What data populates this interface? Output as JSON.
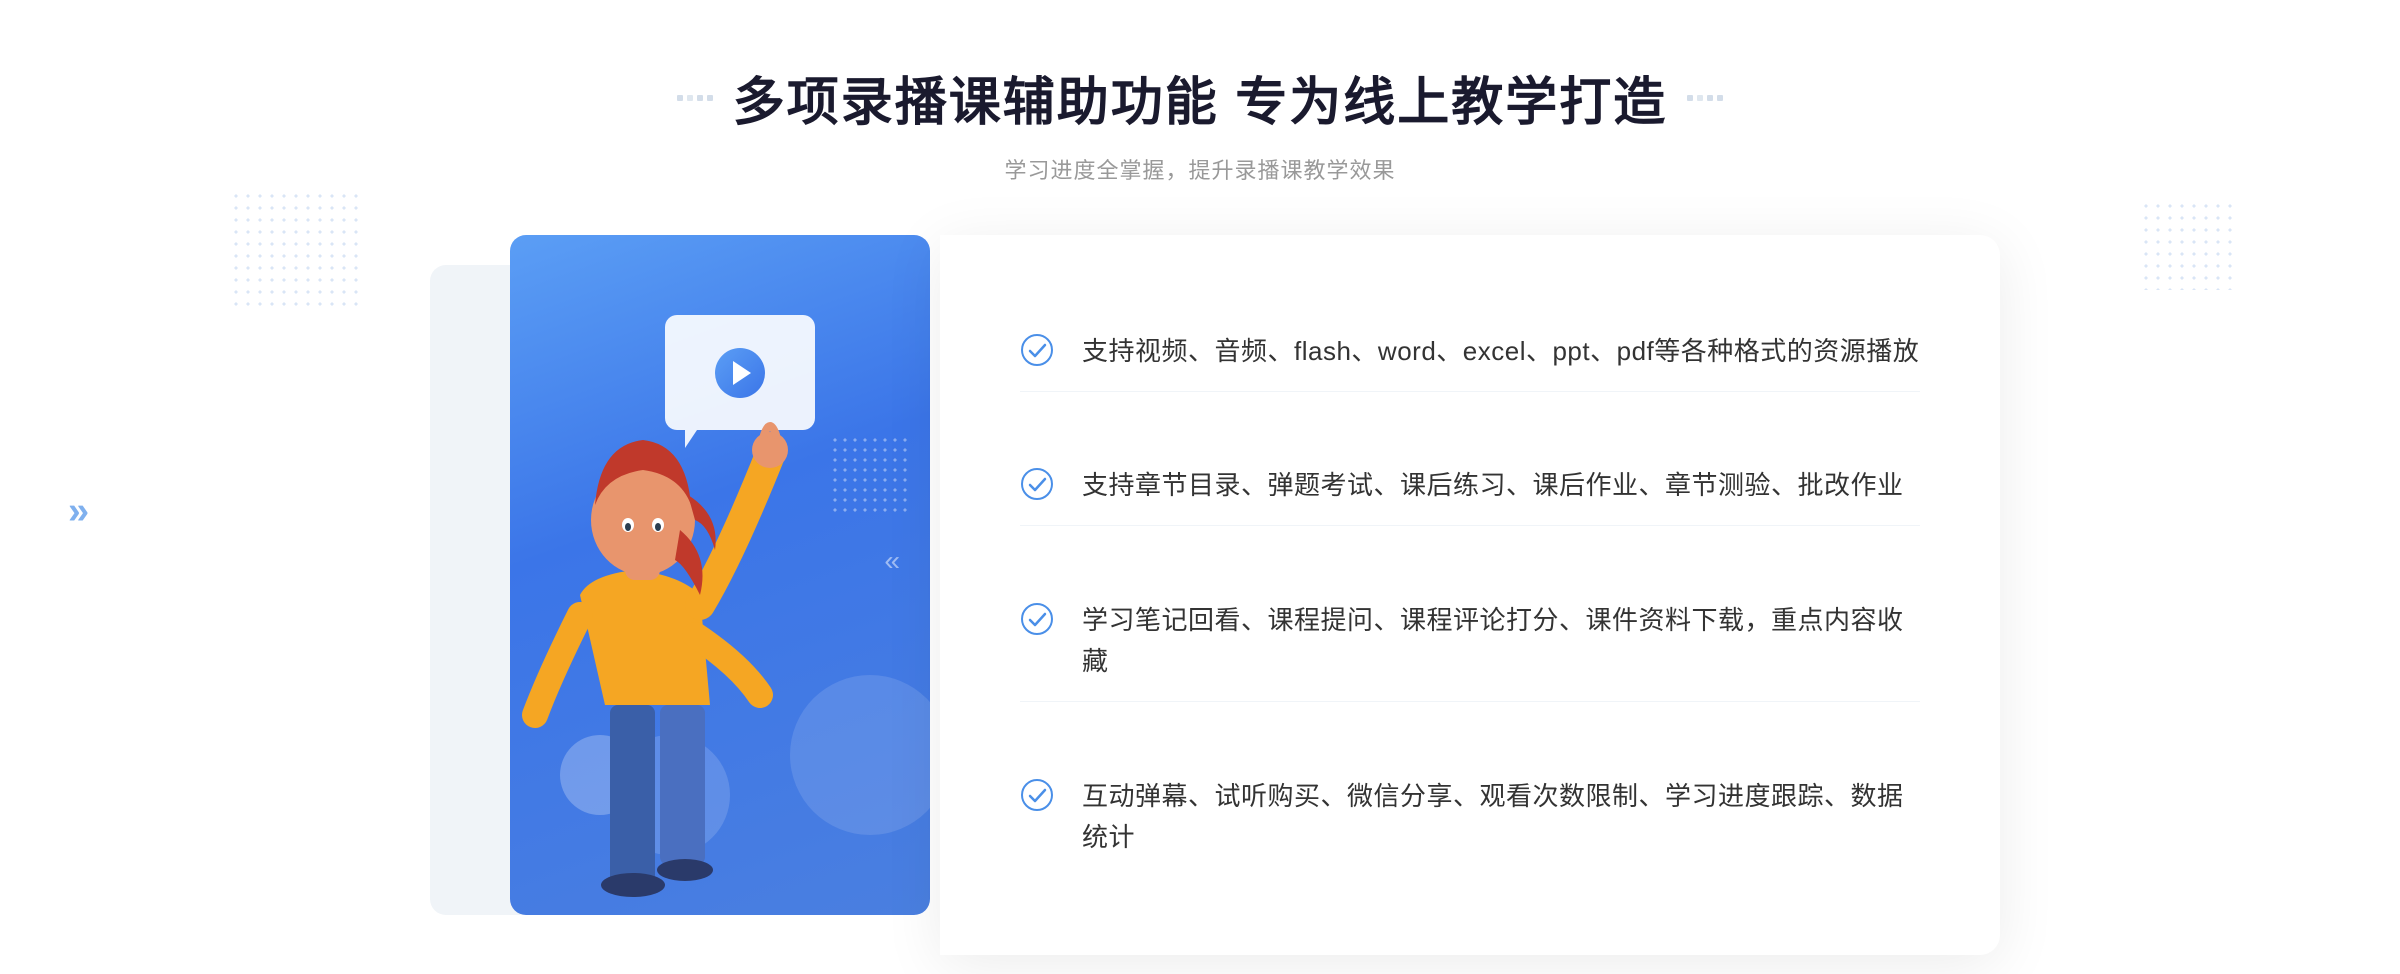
{
  "page": {
    "title": "多项录播课辅助功能 专为线上教学打造",
    "subtitle": "学习进度全掌握，提升录播课教学效果",
    "features": [
      {
        "id": "feature-1",
        "text": "支持视频、音频、flash、word、excel、ppt、pdf等各种格式的资源播放"
      },
      {
        "id": "feature-2",
        "text": "支持章节目录、弹题考试、课后练习、课后作业、章节测验、批改作业"
      },
      {
        "id": "feature-3",
        "text": "学习笔记回看、课程提问、课程评论打分、课件资料下载，重点内容收藏"
      },
      {
        "id": "feature-4",
        "text": "互动弹幕、试听购买、微信分享、观看次数限制、学习进度跟踪、数据统计"
      }
    ],
    "decorators": {
      "title_left": "⁝⁝",
      "title_right": "⁝⁝",
      "chevron_left": "»"
    },
    "colors": {
      "primary_blue": "#3b75e8",
      "light_blue": "#5b9ef5",
      "text_dark": "#1a1a2e",
      "text_gray": "#999999",
      "text_body": "#333333",
      "check_color": "#4a8fe8",
      "bg_card": "#f0f4f8"
    }
  }
}
